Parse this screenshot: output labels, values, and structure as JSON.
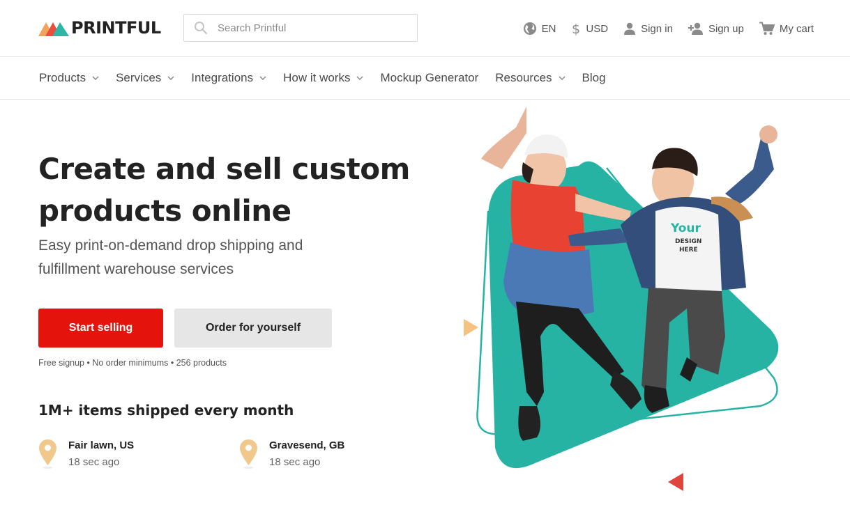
{
  "header": {
    "logo_text": "PRINTFUL",
    "search_placeholder": "Search Printful",
    "language": "EN",
    "currency": "USD",
    "sign_in": "Sign in",
    "sign_up": "Sign up",
    "cart": "My cart"
  },
  "nav": {
    "items": [
      {
        "label": "Products",
        "dropdown": true
      },
      {
        "label": "Services",
        "dropdown": true
      },
      {
        "label": "Integrations",
        "dropdown": true
      },
      {
        "label": "How it works",
        "dropdown": true
      },
      {
        "label": "Mockup Generator",
        "dropdown": false
      },
      {
        "label": "Resources",
        "dropdown": true
      },
      {
        "label": "Blog",
        "dropdown": false
      }
    ]
  },
  "hero": {
    "title_line1": "Create and sell custom",
    "title_line2": "products online",
    "subtitle_line1": "Easy print-on-demand drop shipping and",
    "subtitle_line2": "fulfillment warehouse services",
    "primary_button": "Start selling",
    "secondary_button": "Order for yourself",
    "fine_print": "Free signup • No order minimums • 256 products"
  },
  "shipping": {
    "headline": "1M+ items shipped every month",
    "orders": [
      {
        "city": "Fair lawn, US",
        "time": "18 sec ago"
      },
      {
        "city": "Gravesend, GB",
        "time": "18 sec ago"
      }
    ]
  },
  "illustration": {
    "shirt_text_line1": "Your",
    "shirt_text_line2": "DESIGN",
    "shirt_text_line3": "HERE"
  },
  "colors": {
    "brand_red": "#e4140c",
    "teal": "#26b3a4",
    "pin": "#f0c88c",
    "logo_orange": "#f2a35b",
    "logo_red": "#e94d3f",
    "logo_teal": "#2fb5a6"
  },
  "icons": [
    "search-icon",
    "globe-icon",
    "dollar-icon",
    "user-icon",
    "user-plus-icon",
    "cart-icon",
    "chevron-down-icon",
    "map-pin-icon"
  ]
}
